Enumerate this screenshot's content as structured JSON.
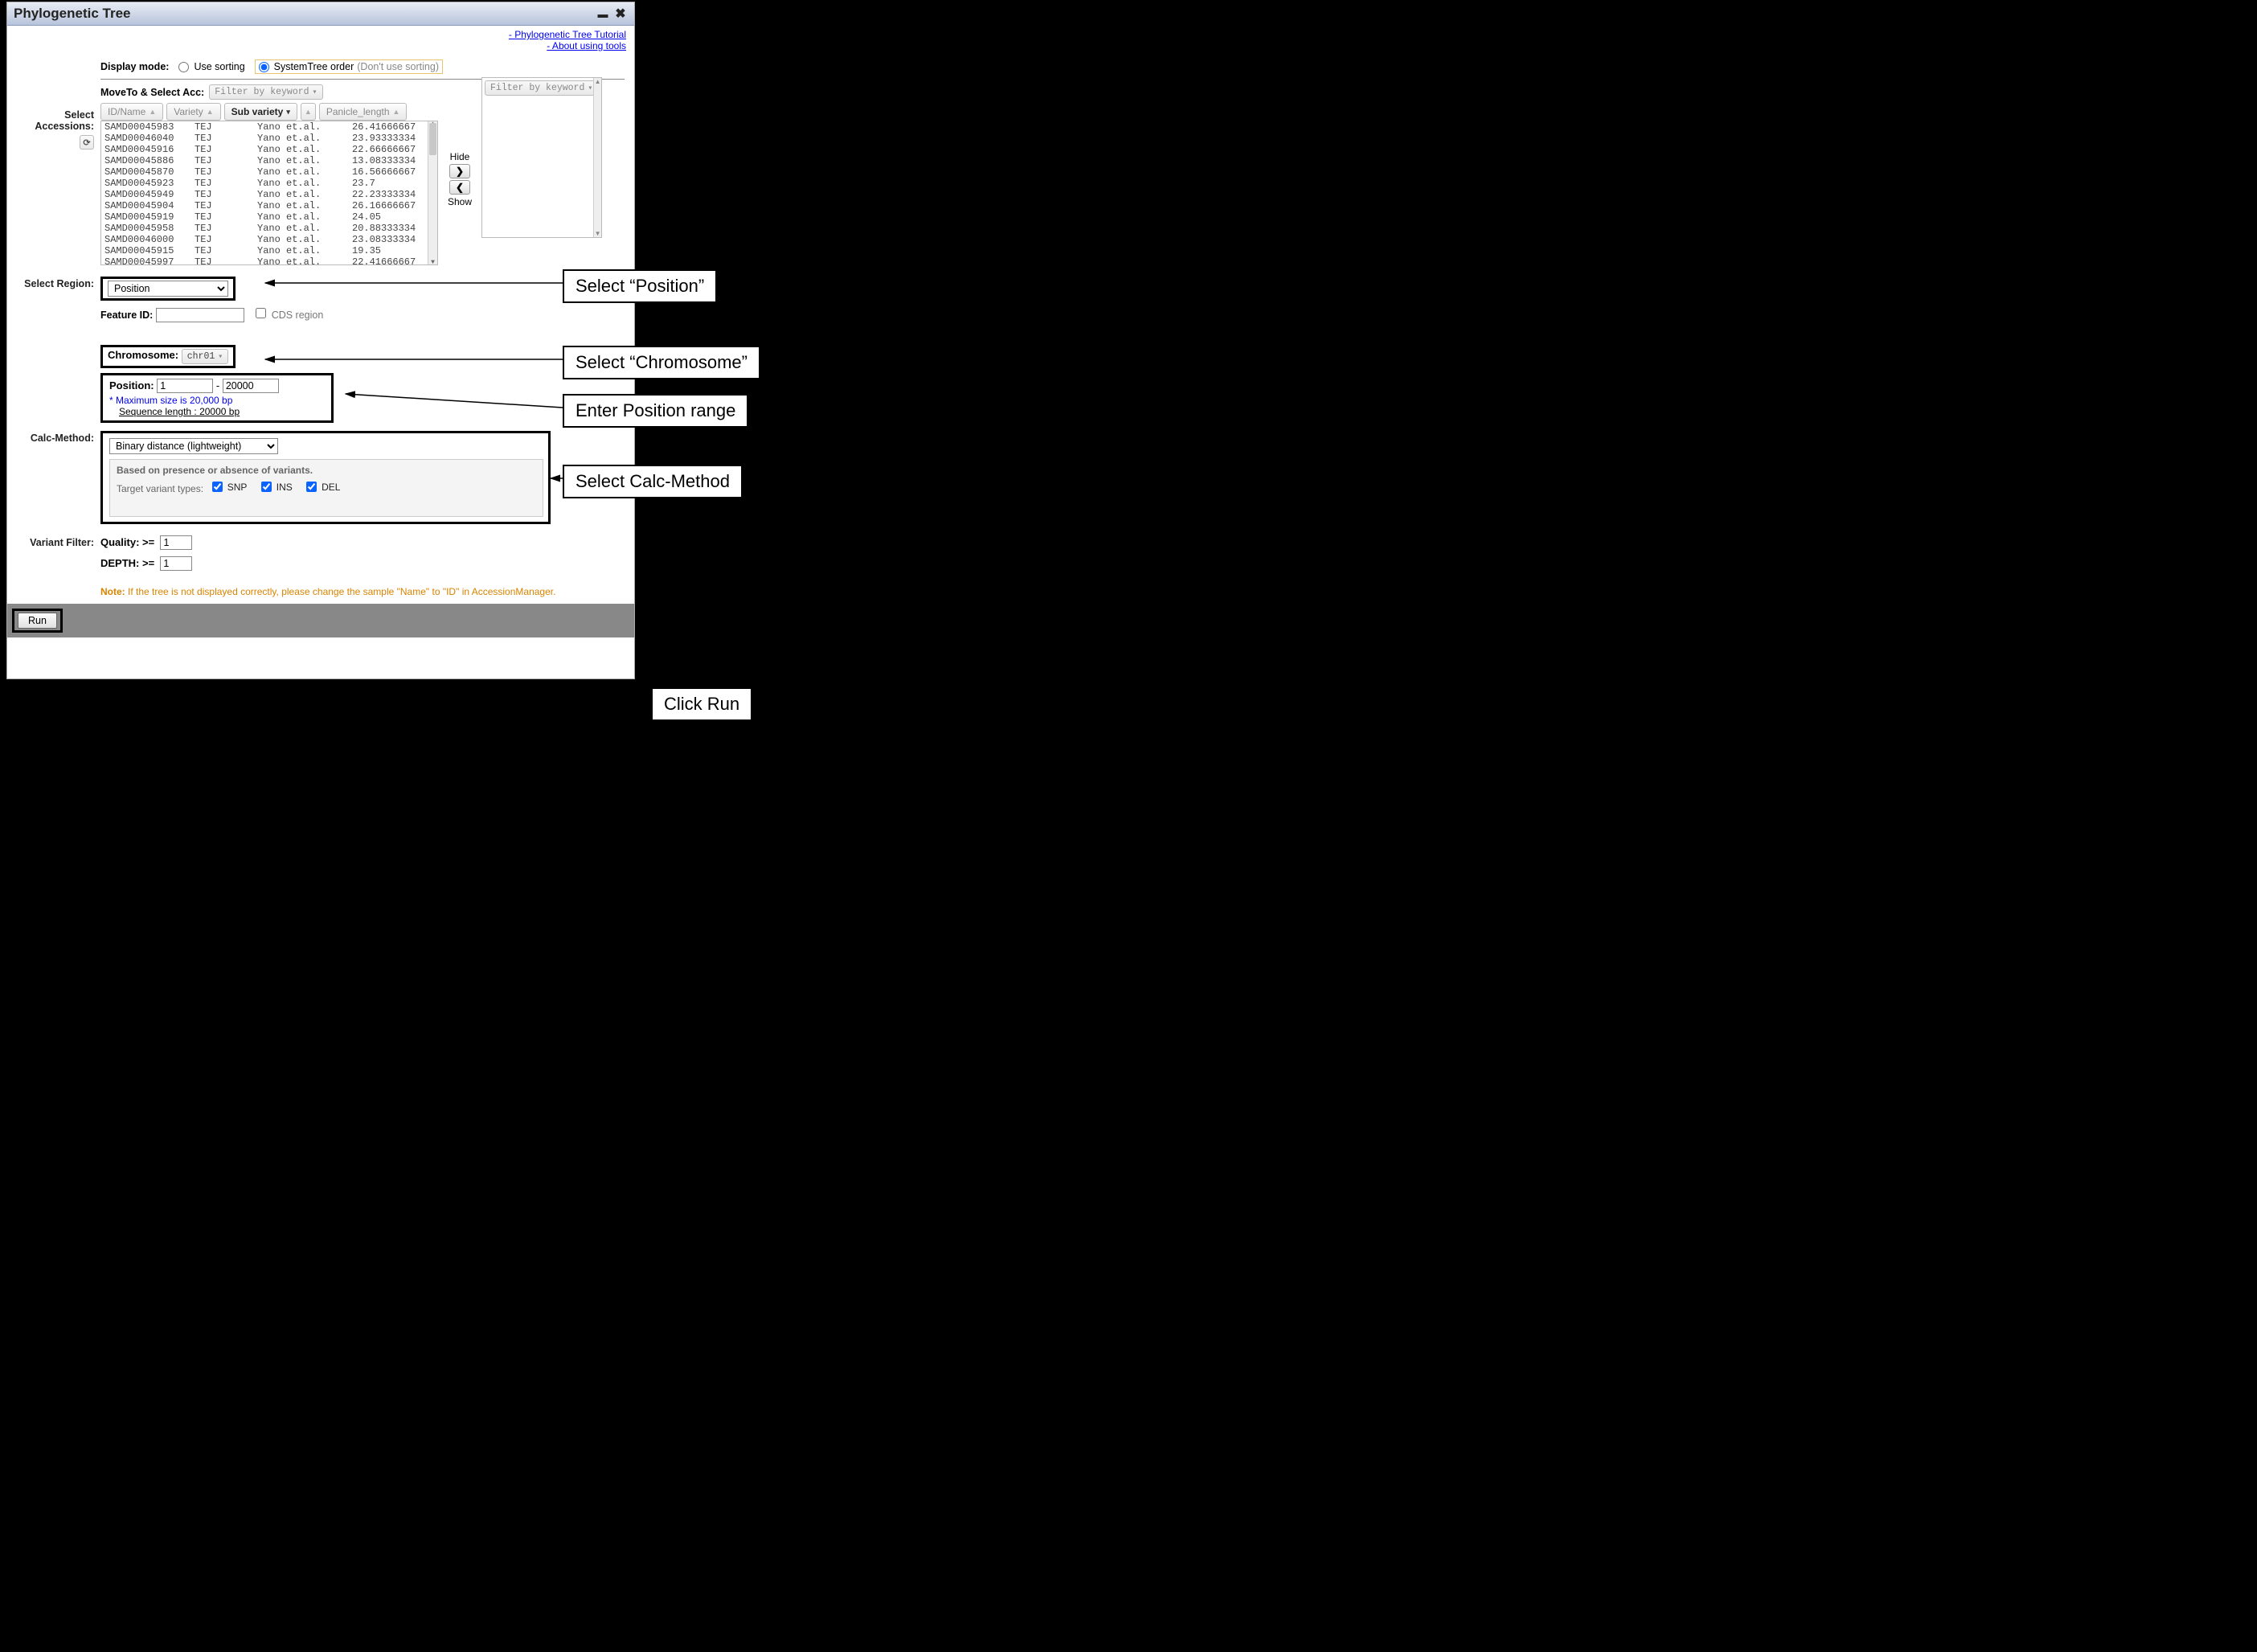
{
  "titlebar": {
    "title": "Phylogenetic Tree"
  },
  "links": {
    "tutorial": "- Phylogenetic Tree Tutorial",
    "about": "- About using tools"
  },
  "displayMode": {
    "label": "Display mode:",
    "opt1": "Use sorting",
    "opt2": "SystemTree order",
    "opt2hint": "(Don't use sorting)"
  },
  "moveto": {
    "label": "MoveTo & Select Acc:",
    "placeholder": "Filter by keyword"
  },
  "columns": {
    "c1": "ID/Name",
    "c2": "Variety",
    "c3": "Sub variety",
    "c4": "Panicle_length"
  },
  "accLabel1": "Select",
  "accLabel2": "Accessions:",
  "accessions": [
    {
      "id": "SAMD00045983",
      "v": "TEJ",
      "sv": "Yano et.al.",
      "pl": "26.41666667"
    },
    {
      "id": "SAMD00046040",
      "v": "TEJ",
      "sv": "Yano et.al.",
      "pl": "23.93333334"
    },
    {
      "id": "SAMD00045916",
      "v": "TEJ",
      "sv": "Yano et.al.",
      "pl": "22.66666667"
    },
    {
      "id": "SAMD00045886",
      "v": "TEJ",
      "sv": "Yano et.al.",
      "pl": "13.08333334"
    },
    {
      "id": "SAMD00045870",
      "v": "TEJ",
      "sv": "Yano et.al.",
      "pl": "16.56666667"
    },
    {
      "id": "SAMD00045923",
      "v": "TEJ",
      "sv": "Yano et.al.",
      "pl": "23.7"
    },
    {
      "id": "SAMD00045949",
      "v": "TEJ",
      "sv": "Yano et.al.",
      "pl": "22.23333334"
    },
    {
      "id": "SAMD00045904",
      "v": "TEJ",
      "sv": "Yano et.al.",
      "pl": "26.16666667"
    },
    {
      "id": "SAMD00045919",
      "v": "TEJ",
      "sv": "Yano et.al.",
      "pl": "24.05"
    },
    {
      "id": "SAMD00045958",
      "v": "TEJ",
      "sv": "Yano et.al.",
      "pl": "20.88333334"
    },
    {
      "id": "SAMD00046000",
      "v": "TEJ",
      "sv": "Yano et.al.",
      "pl": "23.08333334"
    },
    {
      "id": "SAMD00045915",
      "v": "TEJ",
      "sv": "Yano et.al.",
      "pl": "19.35"
    },
    {
      "id": "SAMD00045997",
      "v": "TEJ",
      "sv": "Yano et.al.",
      "pl": "22.41666667"
    }
  ],
  "hideLabel": "Hide",
  "showLabel": "Show",
  "rightFilterPlaceholder": "Filter by keyword",
  "selectRegion": {
    "label": "Select Region:",
    "value": "Position",
    "featureLabel": "Feature ID:",
    "featureValue": "",
    "cdsLabel": "CDS region"
  },
  "chromosome": {
    "label": "Chromosome:",
    "value": "chr01"
  },
  "position": {
    "label": "Position:",
    "from": "1",
    "dash": "-",
    "to": "20000",
    "note": "* Maximum size is 20,000 bp",
    "seqLabel": "Sequence length :  20000 bp"
  },
  "calcMethod": {
    "label": "Calc-Method:",
    "value": "Binary distance (lightweight)",
    "desc": "Based on presence or absence of variants.",
    "targetLabel": "Target variant types:",
    "snp": "SNP",
    "ins": "INS",
    "del": "DEL"
  },
  "variantFilter": {
    "label": "Variant Filter:",
    "qualityLabel": "Quality:  >=",
    "qualityValue": "1",
    "depthLabel": "DEPTH:  >=",
    "depthValue": "1"
  },
  "note": {
    "prefix": "Note:",
    "text": " If the tree is not displayed correctly, please change the sample \"Name\" to \"ID\" in AccessionManager."
  },
  "runLabel": "Run",
  "annotations": {
    "a1": "Select “Position”",
    "a2": "Select “Chromosome”",
    "a3": "Enter Position range",
    "a4": "Select Calc-Method",
    "a5": "Click Run"
  }
}
